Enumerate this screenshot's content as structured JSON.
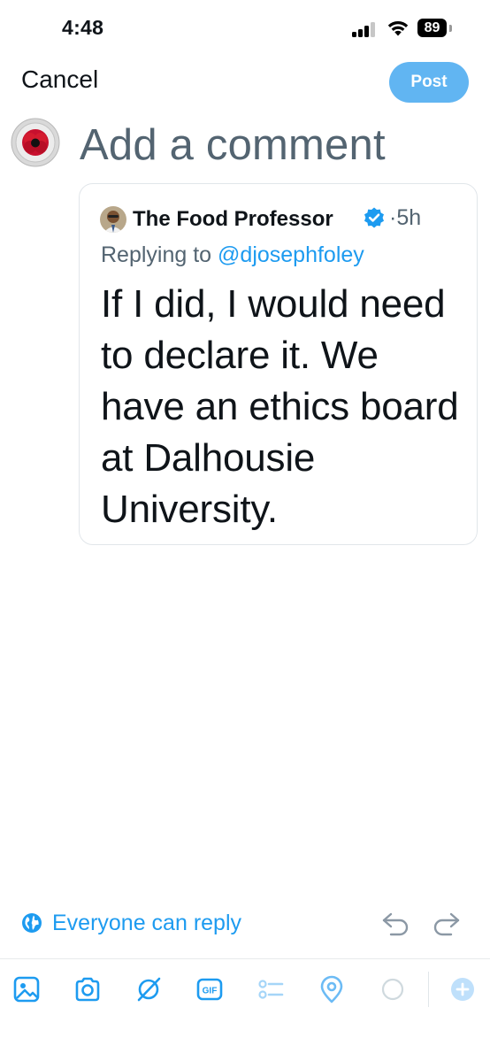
{
  "status_bar": {
    "time": "4:48",
    "battery": "89"
  },
  "header": {
    "cancel_label": "Cancel",
    "post_label": "Post"
  },
  "composer": {
    "placeholder": "Add a comment"
  },
  "quote": {
    "author_name": "The Food Professor",
    "separator": "·",
    "time_ago": "5h",
    "replying_prefix": "Replying to ",
    "replying_handle": "@djosephfoley",
    "text": "If I did, I would need to declare it. We have an ethics board at Dalhousie University."
  },
  "reply_setting": {
    "label": "Everyone can reply"
  },
  "toolbar": {
    "icons": [
      "image-icon",
      "camera-icon",
      "grok-icon",
      "gif-icon",
      "poll-icon",
      "location-icon",
      "character-count-icon",
      "add-post-icon"
    ]
  },
  "colors": {
    "accent": "#1d9bf0",
    "post_button": "#61b5f2",
    "secondary_text": "#536471",
    "primary_text": "#0f1419"
  }
}
